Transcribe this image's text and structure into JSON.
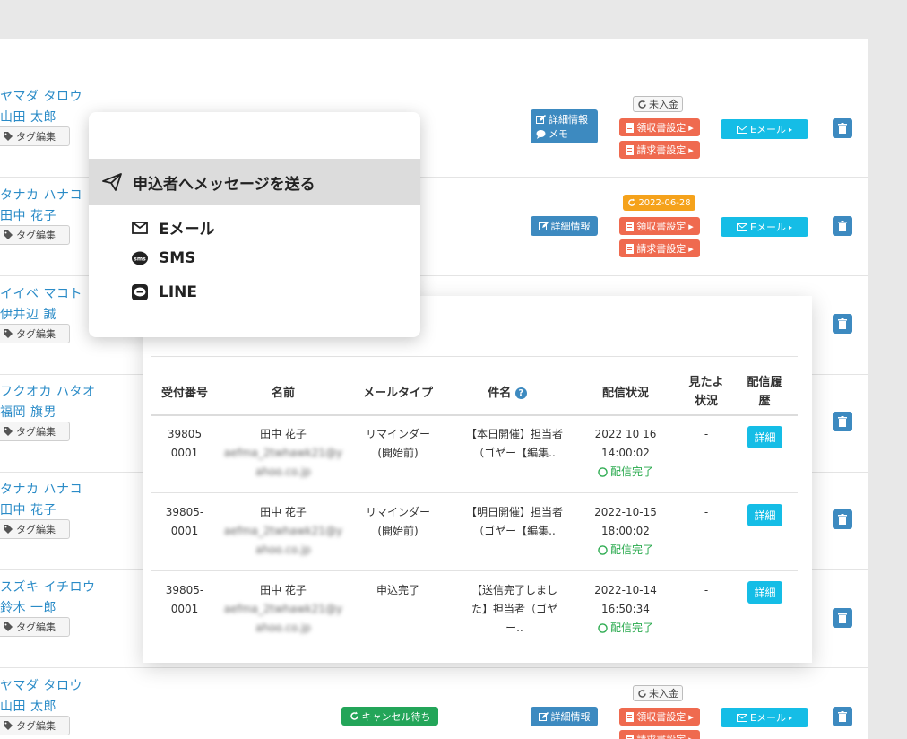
{
  "rows": [
    {
      "kana": "ヤマダ タロウ",
      "kanji": "山田 太郎",
      "tag": "タグ編集",
      "detail": "詳細情報",
      "memo": "メモ",
      "badge": "未入金",
      "receipt": "領収書設定",
      "invoice": "請求書設定",
      "mail": "Eメール"
    },
    {
      "kana": "タナカ ハナコ",
      "kanji": "田中 花子",
      "tag": "タグ編集",
      "detail": "詳細情報",
      "badge": "2022-06-28",
      "receipt": "領収書設定",
      "invoice": "請求書設定",
      "mail": "Eメール"
    },
    {
      "kana": "イイベ マコト",
      "kanji": "伊井辺 誠",
      "tag": "タグ編集"
    },
    {
      "kana": "フクオカ ハタオ",
      "kanji": "福岡 旗男",
      "tag": "タグ編集"
    },
    {
      "kana": "タナカ ハナコ",
      "kanji": "田中 花子",
      "tag": "タグ編集"
    },
    {
      "kana": "スズキ イチロウ",
      "kanji": "鈴木 一郎",
      "tag": "タグ編集"
    },
    {
      "kana": "ヤマダ タロウ",
      "kanji": "山田 太郎",
      "tag": "タグ編集",
      "status": "キャンセル待ち",
      "detail": "詳細情報",
      "badge": "未入金",
      "receipt": "領収書設定",
      "invoice": "請求書設定",
      "mail": "Eメール"
    }
  ],
  "menu": {
    "header": "申込者へメッセージを送る",
    "items": [
      {
        "label": "Eメール",
        "icon": "envelope-icon"
      },
      {
        "label": "SMS",
        "icon": "sms-icon"
      },
      {
        "label": "LINE",
        "icon": "line-icon"
      }
    ]
  },
  "log": {
    "headers": {
      "receipt_no": "受付番号",
      "name": "名前",
      "mail_type": "メールタイプ",
      "subject": "件名",
      "status": "配信状況",
      "seen_1": "見たよ",
      "seen_2": "状況",
      "history_1": "配信履",
      "history_2": "歴"
    },
    "rows": [
      {
        "no_1": "39805",
        "no_2": "0001",
        "name": "田中 花子",
        "email_1": "aefma_2twhawk21@y",
        "email_2": "ahoo.co.jp",
        "type_1": "リマインダー",
        "type_2": "(開始前)",
        "subject_1": "【本日開催】担当者",
        "subject_2": "（ゴヤ゙ー【編集..",
        "date": "2022 10 16",
        "time": "14:00:02",
        "status": "配信完了",
        "seen": "-",
        "detail": "詳細"
      },
      {
        "no_1": "39805-",
        "no_2": "0001",
        "name": "田中 花子",
        "email_1": "aefma_2twhawk21@y",
        "email_2": "ahoo.co.jp",
        "type_1": "リマインダー",
        "type_2": "(開始前)",
        "subject_1": "【明日開催】担当者",
        "subject_2": "（ゴヤ゙ー【編集..",
        "date": "2022-10-15",
        "time": "18:00:02",
        "status": "配信完了",
        "seen": "-",
        "detail": "詳細"
      },
      {
        "no_1": "39805-",
        "no_2": "0001",
        "name": "田中 花子",
        "email_1": "aefma_2twhawk21@y",
        "email_2": "ahoo.co.jp",
        "type_1": "申込完了",
        "type_2": "",
        "subject_1": "【送信完了しまし",
        "subject_2": "た】担当者（ゴヤ゙",
        "subject_3": "ー..",
        "date": "2022-10-14",
        "time": "16:50:34",
        "status": "配信完了",
        "seen": "-",
        "detail": "詳細"
      }
    ]
  },
  "colors": {
    "link": "#2a8bc7",
    "detail_btn": "#3d8ac0",
    "red_btn": "#ef6a4f",
    "mail_btn": "#15bde6",
    "orange": "#f5a21b",
    "green": "#23a559",
    "done": "#2aaa4e"
  }
}
